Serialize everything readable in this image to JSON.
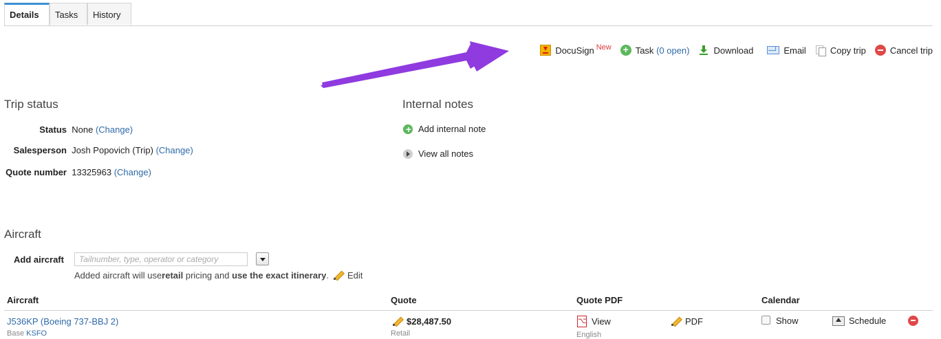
{
  "tabs": [
    {
      "label": "Details",
      "active": true
    },
    {
      "label": "Tasks",
      "active": false
    },
    {
      "label": "History",
      "active": false
    }
  ],
  "actions": {
    "docusign": {
      "label": "DocuSign",
      "badge": "New"
    },
    "task": {
      "label": "Task",
      "count": "(0 open)"
    },
    "download": {
      "label": "Download"
    },
    "email": {
      "label": "Email"
    },
    "copy_trip": {
      "label": "Copy trip"
    },
    "cancel_trip": {
      "label": "Cancel trip"
    }
  },
  "annotation": {
    "arrow_color": "#8f3be0"
  },
  "trip_status": {
    "title": "Trip status",
    "rows": [
      {
        "key": "Status",
        "value": "None",
        "link": "(Change)"
      },
      {
        "key": "Salesperson",
        "value": "Josh Popovich (Trip)",
        "link": "(Change)"
      },
      {
        "key": "Quote number",
        "value": "13325963",
        "link": "(Change)"
      }
    ]
  },
  "internal_notes": {
    "title": "Internal notes",
    "add_label": "Add internal note",
    "view_label": "View all notes"
  },
  "aircraft": {
    "title": "Aircraft",
    "add_label": "Add aircraft",
    "input_placeholder": "Tailnumber, type, operator or category",
    "hint_prefix": "Added aircraft will use ",
    "hint_bold1": "retail",
    "hint_mid": " pricing and ",
    "hint_bold2": "use the exact itinerary",
    "hint_suffix": ".",
    "edit_label": "Edit",
    "columns": [
      "Aircraft",
      "Quote",
      "Quote PDF",
      "Calendar"
    ],
    "rows": [
      {
        "name": "J536KP (Boeing 737-BBJ 2)",
        "base_label": "Base",
        "base_code": "KSFO",
        "quote": "$28,487.50",
        "quote_sub": "Retail",
        "view_label": "View",
        "view_sub": "English",
        "pdf_label": "PDF",
        "show_label": "Show",
        "schedule_label": "Schedule"
      }
    ]
  }
}
